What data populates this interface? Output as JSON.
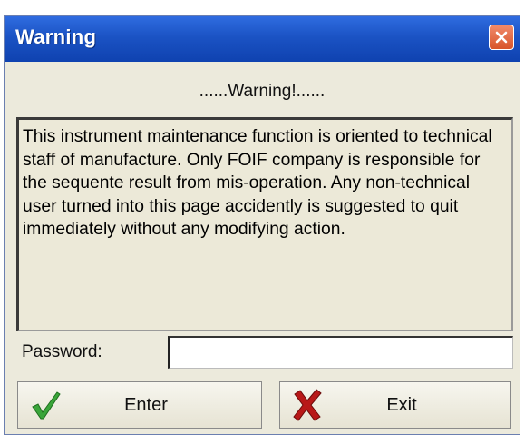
{
  "window": {
    "title": "Warning",
    "close_icon": "close-icon"
  },
  "heading": "......Warning!......",
  "message": "This instrument maintenance function is oriented to technical staff of manufacture. Only FOIF company is responsible for the sequente result from mis-operation. Any non-technical user turned into this page accidently is suggested to quit immediately without any modifying action.",
  "password": {
    "label": "Password:",
    "value": ""
  },
  "buttons": {
    "enter_label": "Enter",
    "enter_icon": "checkmark-icon",
    "exit_label": "Exit",
    "exit_icon": "red-x-icon"
  },
  "colors": {
    "titlebar": "#1b53c4",
    "dialog_bg": "#eceadc",
    "close_button": "#d8542a",
    "check_green": "#3aa53a",
    "exit_red": "#b81818"
  }
}
